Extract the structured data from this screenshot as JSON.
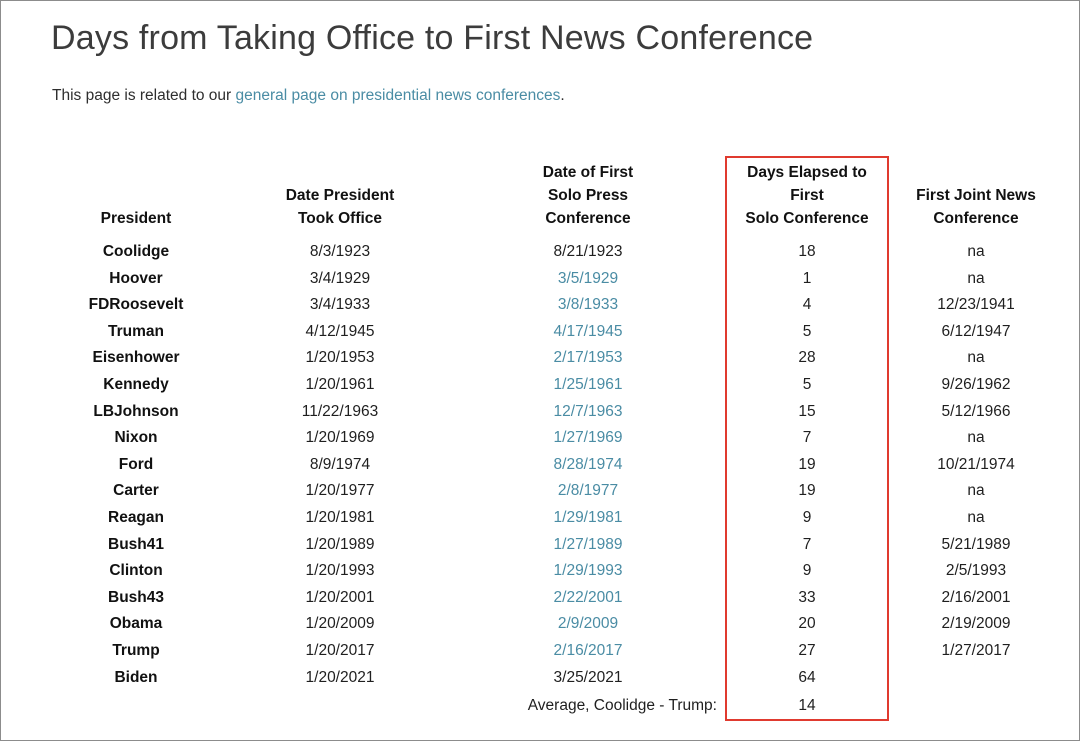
{
  "page": {
    "title": "Days from Taking Office to First News Conference",
    "subtitle_before": "This page is related to our ",
    "subtitle_link": "general page on presidential news conferences",
    "subtitle_after": "."
  },
  "colors": {
    "link": "#4a8ca4",
    "highlight_box": "#e03a2f",
    "title_text": "#3c3c3c",
    "body_text": "#1f1f1f",
    "page_border": "#8c8c8c"
  },
  "table": {
    "headers": {
      "president": "President",
      "took_office_line1": "Date President",
      "took_office_line2": "Took Office",
      "solo_line1": "Date of First",
      "solo_line2": "Solo Press",
      "solo_line3": "Conference",
      "days_line1": "Days Elapsed to",
      "days_line2": "First",
      "days_line3": "Solo Conference",
      "joint_line1": "First Joint News",
      "joint_line2": "Conference"
    },
    "rows": [
      {
        "president": "Coolidge",
        "took_office": "8/3/1923",
        "solo_date": "8/21/1923",
        "solo_is_link": false,
        "days": "18",
        "joint_date": "na"
      },
      {
        "president": "Hoover",
        "took_office": "3/4/1929",
        "solo_date": "3/5/1929",
        "solo_is_link": true,
        "days": "1",
        "joint_date": "na"
      },
      {
        "president": "FDRoosevelt",
        "took_office": "3/4/1933",
        "solo_date": "3/8/1933",
        "solo_is_link": true,
        "days": "4",
        "joint_date": "12/23/1941"
      },
      {
        "president": "Truman",
        "took_office": "4/12/1945",
        "solo_date": "4/17/1945",
        "solo_is_link": true,
        "days": "5",
        "joint_date": "6/12/1947"
      },
      {
        "president": "Eisenhower",
        "took_office": "1/20/1953",
        "solo_date": "2/17/1953",
        "solo_is_link": true,
        "days": "28",
        "joint_date": "na"
      },
      {
        "president": "Kennedy",
        "took_office": "1/20/1961",
        "solo_date": "1/25/1961",
        "solo_is_link": true,
        "days": "5",
        "joint_date": "9/26/1962"
      },
      {
        "president": "LBJohnson",
        "took_office": "11/22/1963",
        "solo_date": "12/7/1963",
        "solo_is_link": true,
        "days": "15",
        "joint_date": "5/12/1966"
      },
      {
        "president": "Nixon",
        "took_office": "1/20/1969",
        "solo_date": "1/27/1969",
        "solo_is_link": true,
        "days": "7",
        "joint_date": "na"
      },
      {
        "president": "Ford",
        "took_office": "8/9/1974",
        "solo_date": "8/28/1974",
        "solo_is_link": true,
        "days": "19",
        "joint_date": "10/21/1974"
      },
      {
        "president": "Carter",
        "took_office": "1/20/1977",
        "solo_date": "2/8/1977",
        "solo_is_link": true,
        "days": "19",
        "joint_date": "na"
      },
      {
        "president": "Reagan",
        "took_office": "1/20/1981",
        "solo_date": "1/29/1981",
        "solo_is_link": true,
        "days": "9",
        "joint_date": "na"
      },
      {
        "president": "Bush41",
        "took_office": "1/20/1989",
        "solo_date": "1/27/1989",
        "solo_is_link": true,
        "days": "7",
        "joint_date": "5/21/1989"
      },
      {
        "president": "Clinton",
        "took_office": "1/20/1993",
        "solo_date": "1/29/1993",
        "solo_is_link": true,
        "days": "9",
        "joint_date": "2/5/1993"
      },
      {
        "president": "Bush43",
        "took_office": "1/20/2001",
        "solo_date": "2/22/2001",
        "solo_is_link": true,
        "days": "33",
        "joint_date": "2/16/2001"
      },
      {
        "president": "Obama",
        "took_office": "1/20/2009",
        "solo_date": "2/9/2009",
        "solo_is_link": true,
        "days": "20",
        "joint_date": "2/19/2009"
      },
      {
        "president": "Trump",
        "took_office": "1/20/2017",
        "solo_date": "2/16/2017",
        "solo_is_link": true,
        "days": "27",
        "joint_date": "1/27/2017"
      },
      {
        "president": "Biden",
        "took_office": "1/20/2021",
        "solo_date": "3/25/2021",
        "solo_is_link": false,
        "days": "64",
        "joint_date": ""
      }
    ],
    "average": {
      "label": "Average, Coolidge - Trump:",
      "value": "14"
    }
  },
  "chart_data": {
    "type": "table",
    "title": "Days from Taking Office to First News Conference",
    "columns": [
      "President",
      "Date President Took Office",
      "Date of First Solo Press Conference",
      "Days Elapsed to First Solo Conference",
      "First Joint News Conference"
    ],
    "categories": [
      "Coolidge",
      "Hoover",
      "FDRoosevelt",
      "Truman",
      "Eisenhower",
      "Kennedy",
      "LBJohnson",
      "Nixon",
      "Ford",
      "Carter",
      "Reagan",
      "Bush41",
      "Clinton",
      "Bush43",
      "Obama",
      "Trump",
      "Biden"
    ],
    "values": [
      18,
      1,
      4,
      5,
      28,
      5,
      15,
      7,
      19,
      19,
      9,
      7,
      9,
      33,
      20,
      27,
      64
    ],
    "ylabel": "Days Elapsed to First Solo Conference",
    "xlabel": "President",
    "annotations": [
      "Average, Coolidge - Trump: 14"
    ],
    "highlighted_column": "Days Elapsed to First Solo Conference"
  }
}
